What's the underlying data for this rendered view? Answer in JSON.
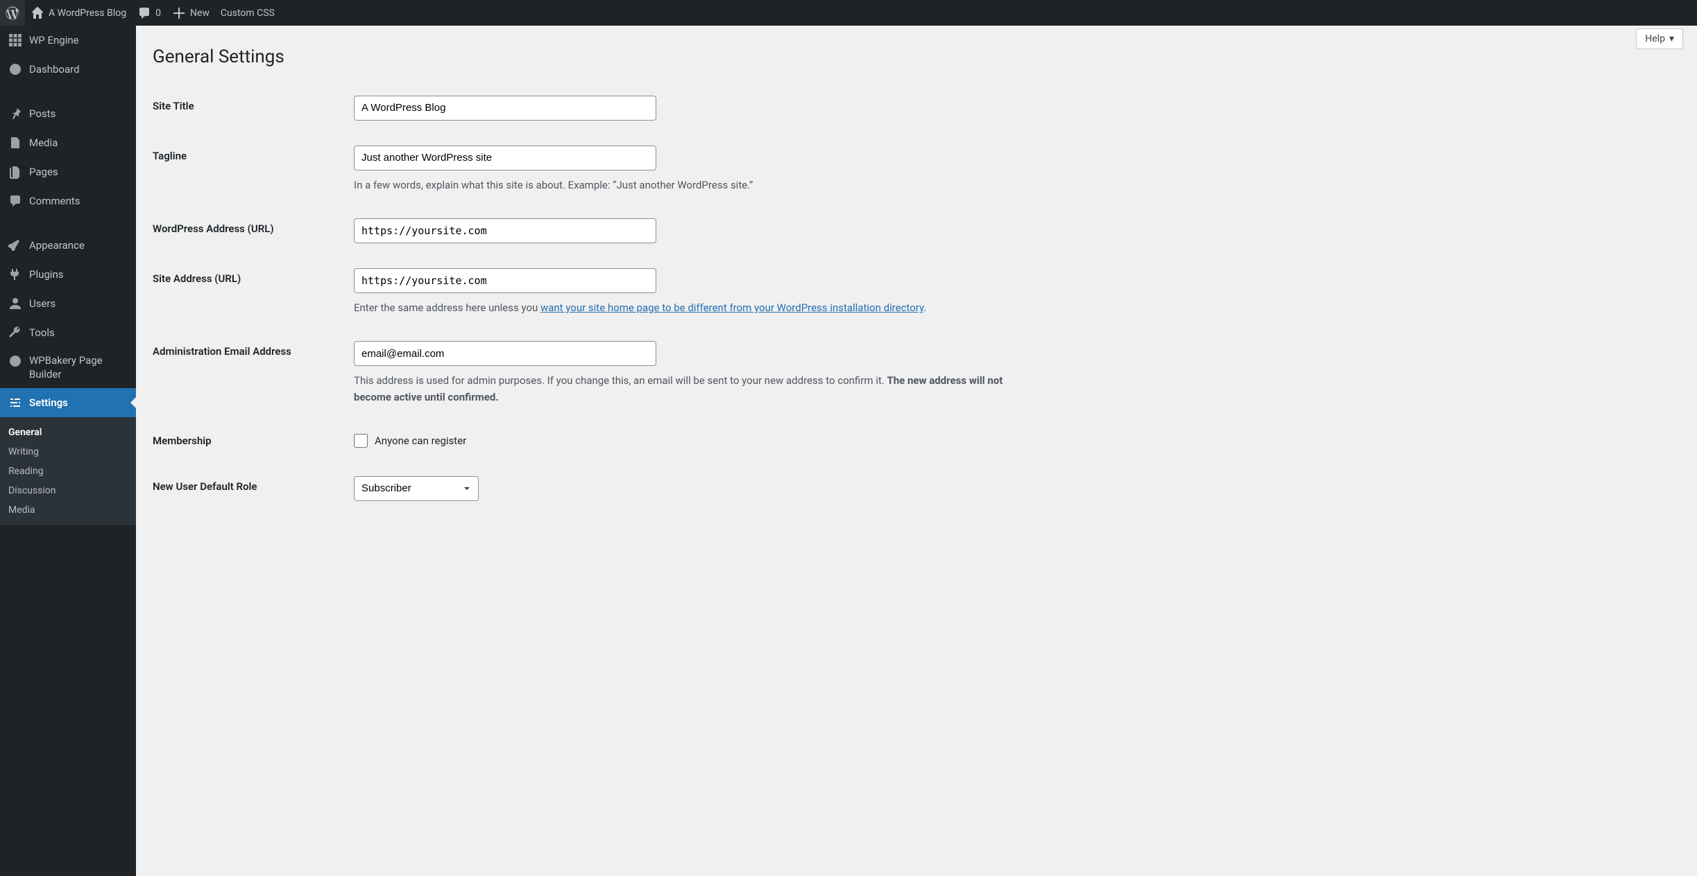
{
  "adminbar": {
    "site_name": "A WordPress Blog",
    "comments_count": "0",
    "new_label": "New",
    "custom_css_label": "Custom CSS"
  },
  "sidebar": {
    "items": [
      {
        "id": "wpengine",
        "label": "WP Engine"
      },
      {
        "id": "dashboard",
        "label": "Dashboard"
      },
      {
        "id": "posts",
        "label": "Posts"
      },
      {
        "id": "media",
        "label": "Media"
      },
      {
        "id": "pages",
        "label": "Pages"
      },
      {
        "id": "comments",
        "label": "Comments"
      },
      {
        "id": "appearance",
        "label": "Appearance"
      },
      {
        "id": "plugins",
        "label": "Plugins"
      },
      {
        "id": "users",
        "label": "Users"
      },
      {
        "id": "tools",
        "label": "Tools"
      },
      {
        "id": "wpbakery",
        "label": "WPBakery Page Builder"
      },
      {
        "id": "settings",
        "label": "Settings"
      }
    ],
    "settings_submenu": [
      {
        "id": "general",
        "label": "General"
      },
      {
        "id": "writing",
        "label": "Writing"
      },
      {
        "id": "reading",
        "label": "Reading"
      },
      {
        "id": "discussion",
        "label": "Discussion"
      },
      {
        "id": "media",
        "label": "Media"
      }
    ]
  },
  "page": {
    "title": "General Settings",
    "help_label": "Help"
  },
  "form": {
    "site_title_label": "Site Title",
    "site_title_value": "A WordPress Blog",
    "tagline_label": "Tagline",
    "tagline_value": "Just another WordPress site",
    "tagline_help": "In a few words, explain what this site is about. Example: “Just another WordPress site.”",
    "wp_address_label": "WordPress Address (URL)",
    "wp_address_value": "https://yoursite.com",
    "site_address_label": "Site Address (URL)",
    "site_address_value": "https://yoursite.com",
    "site_address_help_prefix": "Enter the same address here unless you ",
    "site_address_help_link": "want your site home page to be different from your WordPress installation directory",
    "site_address_help_suffix": ".",
    "admin_email_label": "Administration Email Address",
    "admin_email_value": "email@email.com",
    "admin_email_help_1": "This address is used for admin purposes. If you change this, an email will be sent to your new address to confirm it. ",
    "admin_email_help_2": "The new address will not become active until confirmed.",
    "membership_label": "Membership",
    "membership_checkbox_label": "Anyone can register",
    "new_user_role_label": "New User Default Role",
    "new_user_role_value": "Subscriber"
  }
}
